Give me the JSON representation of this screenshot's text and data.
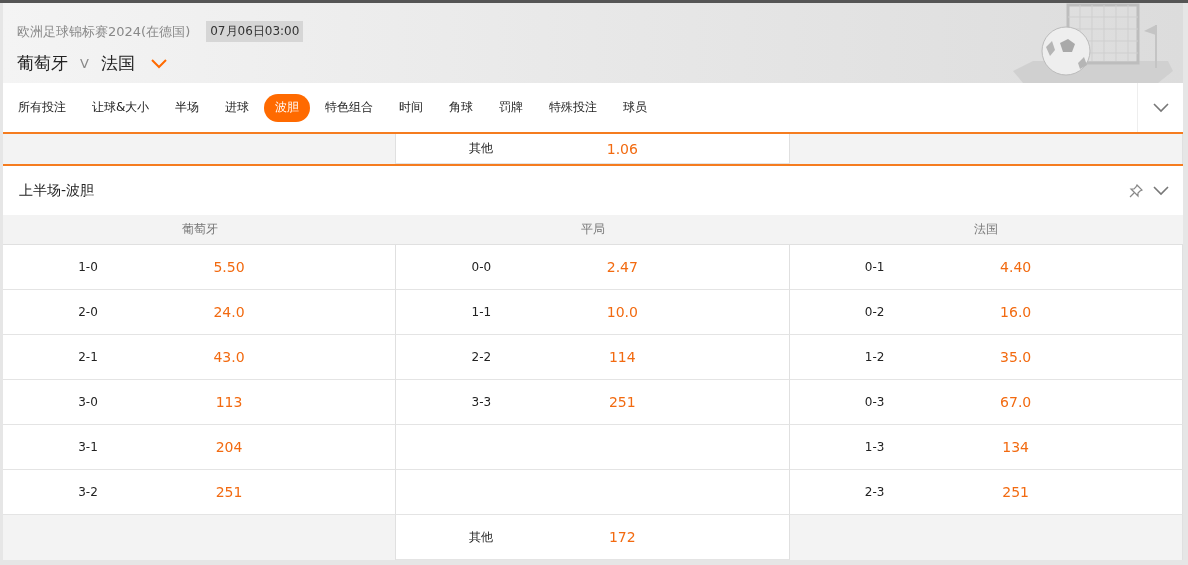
{
  "match": {
    "tournament": "欧洲足球锦标赛2024(在德国)",
    "datetime": "07月06日03:00",
    "home": "葡萄牙",
    "vs": "V",
    "away": "法国"
  },
  "tabs": [
    {
      "label": "所有投注",
      "selected": false
    },
    {
      "label": "让球&大小",
      "selected": false
    },
    {
      "label": "半场",
      "selected": false
    },
    {
      "label": "进球",
      "selected": false
    },
    {
      "label": "波胆",
      "selected": true
    },
    {
      "label": "特色组合",
      "selected": false
    },
    {
      "label": "时间",
      "selected": false
    },
    {
      "label": "角球",
      "selected": false
    },
    {
      "label": "罚牌",
      "selected": false
    },
    {
      "label": "特殊投注",
      "selected": false
    },
    {
      "label": "球员",
      "selected": false
    }
  ],
  "previous_other": {
    "label": "其他",
    "odds": "1.06"
  },
  "section": {
    "title": "上半场-波胆",
    "expanded": true,
    "columns": [
      {
        "header": "葡萄牙",
        "outcomes": [
          {
            "score": "1-0",
            "odds": "5.50"
          },
          {
            "score": "2-0",
            "odds": "24.0"
          },
          {
            "score": "2-1",
            "odds": "43.0"
          },
          {
            "score": "3-0",
            "odds": "113"
          },
          {
            "score": "3-1",
            "odds": "204"
          },
          {
            "score": "3-2",
            "odds": "251"
          }
        ]
      },
      {
        "header": "平局",
        "outcomes": [
          {
            "score": "0-0",
            "odds": "2.47"
          },
          {
            "score": "1-1",
            "odds": "10.0"
          },
          {
            "score": "2-2",
            "odds": "114"
          },
          {
            "score": "3-3",
            "odds": "251"
          }
        ]
      },
      {
        "header": "法国",
        "outcomes": [
          {
            "score": "0-1",
            "odds": "4.40"
          },
          {
            "score": "0-2",
            "odds": "16.0"
          },
          {
            "score": "1-2",
            "odds": "35.0"
          },
          {
            "score": "0-3",
            "odds": "67.0"
          },
          {
            "score": "1-3",
            "odds": "134"
          },
          {
            "score": "2-3",
            "odds": "251"
          }
        ]
      }
    ],
    "other": {
      "label": "其他",
      "odds": "172"
    }
  }
}
